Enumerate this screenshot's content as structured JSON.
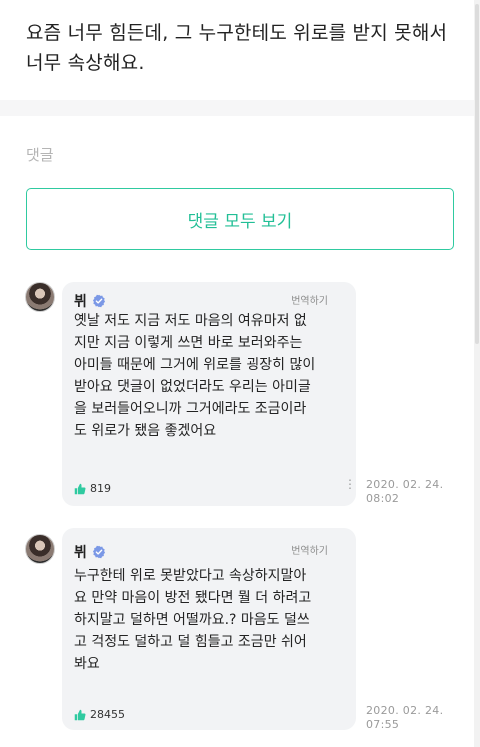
{
  "post": {
    "text_line1": "요즘 너무 힘든데, 그 누구한테도 위로를 받지 못해서",
    "text_line2": "너무 속상해요."
  },
  "comments_section": {
    "heading": "댓글",
    "view_all_label": "댓글 모두 보기"
  },
  "comments": [
    {
      "author": "뷔",
      "verified": true,
      "translate_label": "번역하기",
      "lines": [
        "옛날 저도 지금 저도 마음의 여유마저 없",
        "지만 지금 이렇게 쓰면 바로 보러와주는",
        "아미들 때문에 그거에 위로를 굉장히 많이",
        "받아요 댓글이 없었더라도 우리는 아미글",
        "을 보러들어오니까 그거에라도 조금이라",
        "도 위로가 됐음 좋겠어요"
      ],
      "likes": "819",
      "date": "2020. 02. 24.",
      "time": "08:02"
    },
    {
      "author": "뷔",
      "verified": true,
      "translate_label": "번역하기",
      "lines": [
        "누구한테 위로 못받았다고 속상하지말아",
        "요 만약 마음이 방전 됐다면 뭘 더 하려고",
        "하지말고 덜하면 어떨까요.? 마음도 덜쓰",
        "고 걱정도 덜하고 덜 힘들고 조금만 쉬어",
        "봐요"
      ],
      "likes": "28455",
      "date": "2020. 02. 24.",
      "time": "07:55"
    }
  ],
  "colors": {
    "accent": "#2fcaa0",
    "verified": "#7b98e6",
    "like_icon": "#2fcaa0"
  }
}
